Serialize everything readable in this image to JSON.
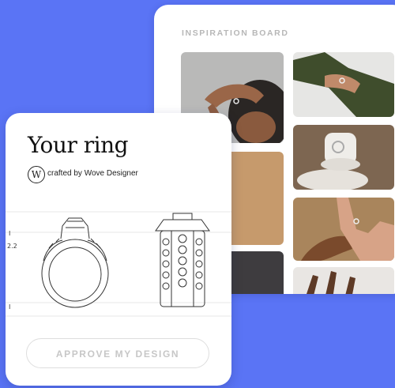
{
  "board": {
    "title": "INSPIRATION BOARD"
  },
  "card": {
    "title": "Your ring",
    "badge_letter": "W",
    "credit": "crafted by Wove Designer",
    "approve_label": "APPROVE MY DESIGN"
  },
  "colors": {
    "background": "#5a74f5",
    "card": "#ffffff",
    "button_text": "#c7c7c7"
  },
  "icons": [
    "wove-logo-icon"
  ]
}
